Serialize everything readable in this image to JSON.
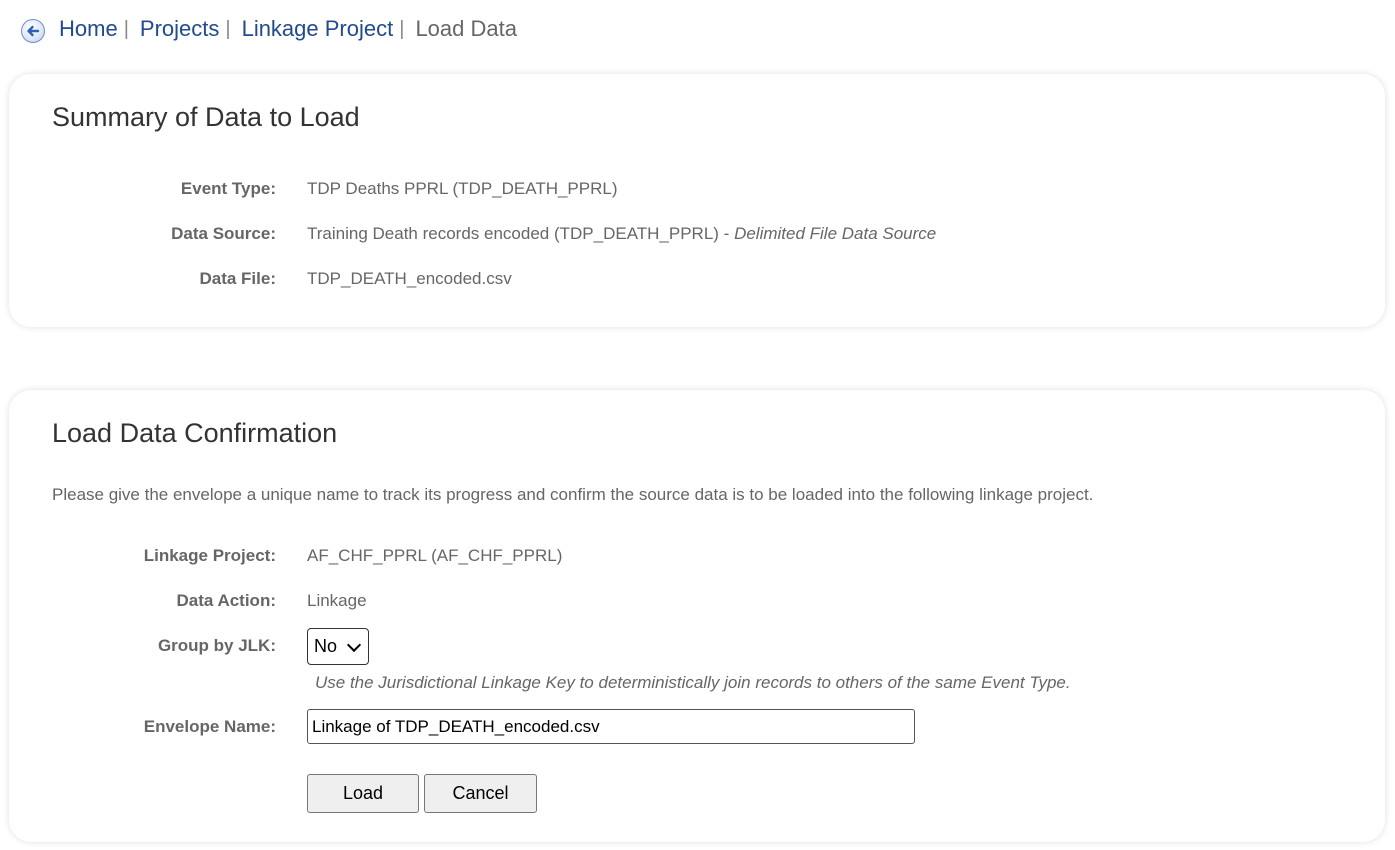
{
  "breadcrumb": {
    "back_icon": "back-arrow-icon",
    "items": [
      {
        "label": "Home"
      },
      {
        "label": "Projects"
      },
      {
        "label": "Linkage Project"
      }
    ],
    "separator": "|",
    "current": "Load Data"
  },
  "summary": {
    "title": "Summary of Data to Load",
    "event_type_label": "Event Type:",
    "event_type_value": "TDP Deaths PPRL (TDP_DEATH_PPRL)",
    "data_source_label": "Data Source:",
    "data_source_value": "Training Death records encoded (TDP_DEATH_PPRL) - ",
    "data_source_type": "Delimited File Data Source",
    "data_file_label": "Data File:",
    "data_file_value": "TDP_DEATH_encoded.csv"
  },
  "confirmation": {
    "title": "Load Data Confirmation",
    "intro": "Please give the envelope a unique name to track its progress and confirm the source data is to be loaded into the following linkage project.",
    "linkage_project_label": "Linkage Project:",
    "linkage_project_value": "AF_CHF_PPRL (AF_CHF_PPRL)",
    "data_action_label": "Data Action:",
    "data_action_value": "Linkage",
    "group_by_jlk_label": "Group by JLK:",
    "group_by_jlk_value": "No",
    "group_by_jlk_hint": "Use the Jurisdictional Linkage Key to deterministically join records to others of the same Event Type.",
    "envelope_name_label": "Envelope Name:",
    "envelope_name_value": "Linkage of TDP_DEATH_encoded.csv",
    "load_button": "Load",
    "cancel_button": "Cancel"
  },
  "colors": {
    "link": "#214a8f",
    "text": "#666666",
    "title": "#333333"
  }
}
